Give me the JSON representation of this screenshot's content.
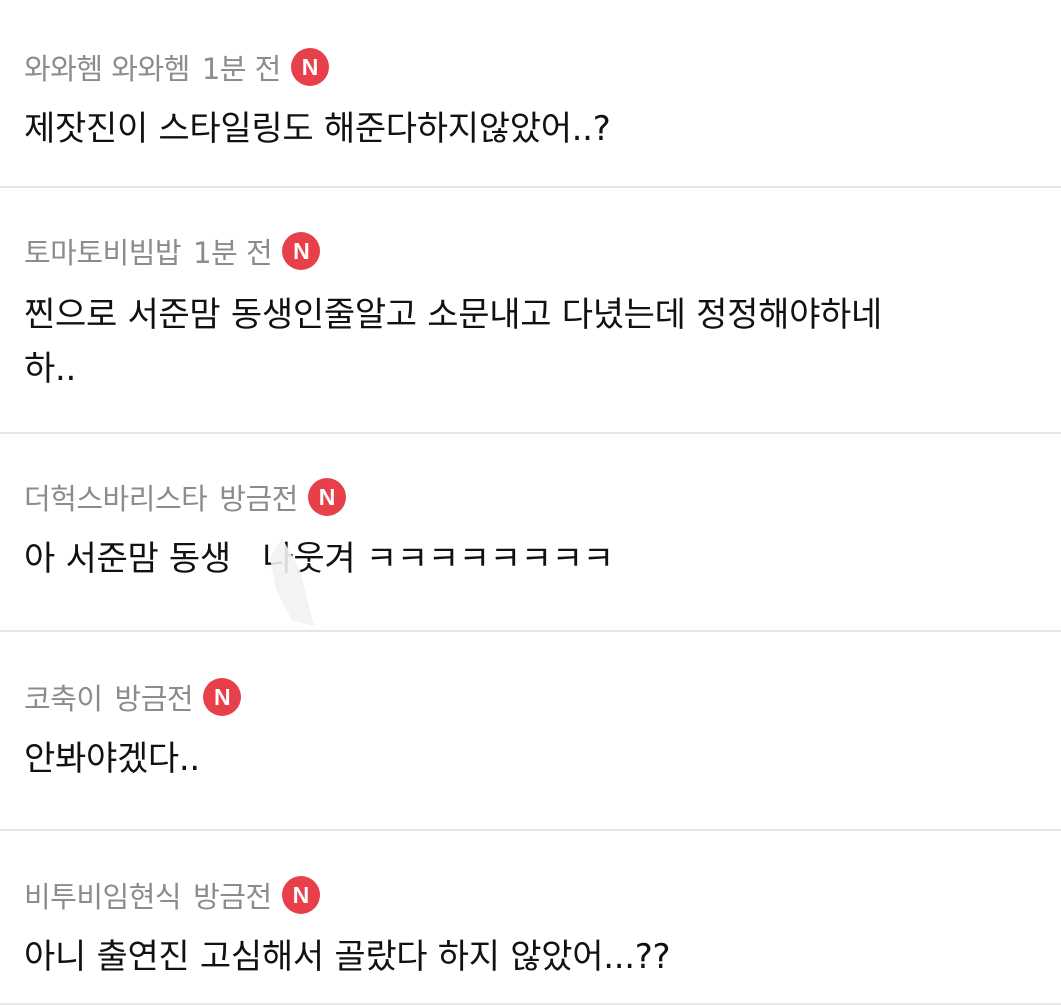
{
  "comments": [
    {
      "author": "와와헴 와와헴",
      "time": "1분 전",
      "badge": "N",
      "text": "제잣진이 스타일링도 해준다하지않았어..?"
    },
    {
      "author": "토마토비빔밥",
      "time": "1분 전",
      "badge": "N",
      "text": "찐으로 서준맘 동생인줄알고 소문내고 다녔는데 정정해야하네\n하.."
    },
    {
      "author": "더헉스바리스타",
      "time": "방금전",
      "badge": "N",
      "text": "아 서준맘 동생   나웃겨 ㅋㅋㅋㅋㅋㅋㅋㅋ"
    },
    {
      "author": "코축이",
      "time": "방금전",
      "badge": "N",
      "text": "안봐야겠다.."
    },
    {
      "author": "비투비임현식",
      "time": "방금전",
      "badge": "N",
      "text": "아니 출연진 고심해서 골랐다 하지 않았어...??"
    }
  ],
  "colors": {
    "badge": "#e8404a",
    "meta_text": "#8c8c8c",
    "body_text": "#111111",
    "divider": "#e6e6e6"
  }
}
